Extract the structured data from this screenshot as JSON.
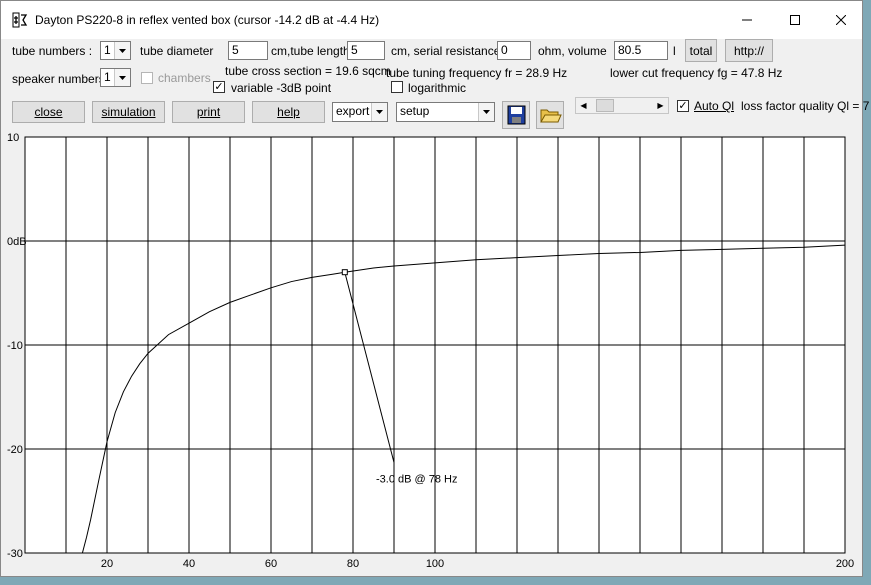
{
  "window": {
    "title": "Dayton PS220-8 in reflex vented box (cursor -14.2 dB at -4.4 Hz)"
  },
  "row1": {
    "tube_numbers_label": "tube numbers :",
    "tube_numbers_value": "1",
    "tube_diameter_label": "tube diameter",
    "tube_diameter_value": "5",
    "tube_length_label": "cm,tube length",
    "tube_length_value": "5",
    "serial_resistance_label": "cm, serial resistance",
    "serial_resistance_value": "0",
    "volume_label": "ohm, volume",
    "volume_value": "80.5",
    "volume_unit": "l",
    "total_label": "total",
    "http_label": "http://"
  },
  "row2": {
    "speaker_numbers_label": "speaker numbers :",
    "speaker_numbers_value": "1",
    "chambers_label": "chambers",
    "tube_cross_section": "tube cross section = 19.6 sqcm",
    "tuning_frequency": "tube tuning frequency fr = 28.9 Hz",
    "lower_cut_frequency": "lower cut frequency fg = 47.8 Hz",
    "variable_3db_label": "variable -3dB point",
    "logarithmic_label": "logarithmic"
  },
  "row3": {
    "close_label": "close",
    "simulation_label": "simulation",
    "print_label": "print",
    "help_label": "help",
    "export_label": "export",
    "setup_label": "setup",
    "auto_ql_label": "Auto Ql",
    "loss_factor": "loss factor quality Ql = 7"
  },
  "chart_data": {
    "type": "line",
    "x_ticks": [
      20,
      40,
      60,
      80,
      100,
      200
    ],
    "y_ticks": [
      "10",
      "0dB",
      "-10",
      "-20",
      "-30"
    ],
    "xlim": [
      0,
      200
    ],
    "ylim": [
      -30,
      10
    ],
    "grid": true,
    "series": [
      {
        "x": [
          14,
          15,
          16,
          18,
          20,
          22,
          24,
          26,
          28,
          30,
          35,
          40,
          45,
          50,
          55,
          60,
          65,
          70,
          75,
          78,
          85,
          90,
          100,
          110,
          120,
          130,
          140,
          150,
          160,
          170,
          180,
          190,
          200
        ],
        "y": [
          -30,
          -28.5,
          -26.8,
          -23,
          -19.3,
          -16.5,
          -14.5,
          -13,
          -11.8,
          -10.8,
          -9,
          -7.9,
          -6.8,
          -5.9,
          -5.2,
          -4.5,
          -3.9,
          -3.5,
          -3.2,
          -3.0,
          -2.6,
          -2.4,
          -2.1,
          -1.8,
          -1.6,
          -1.4,
          -1.2,
          -1.1,
          -0.9,
          -0.8,
          -0.7,
          -0.6,
          -0.4
        ]
      }
    ],
    "marker": {
      "x": 78,
      "y": -3.0
    },
    "annotation": {
      "text": "-3.0 dB @ 78 Hz",
      "x": 90,
      "y": -21.3
    }
  }
}
